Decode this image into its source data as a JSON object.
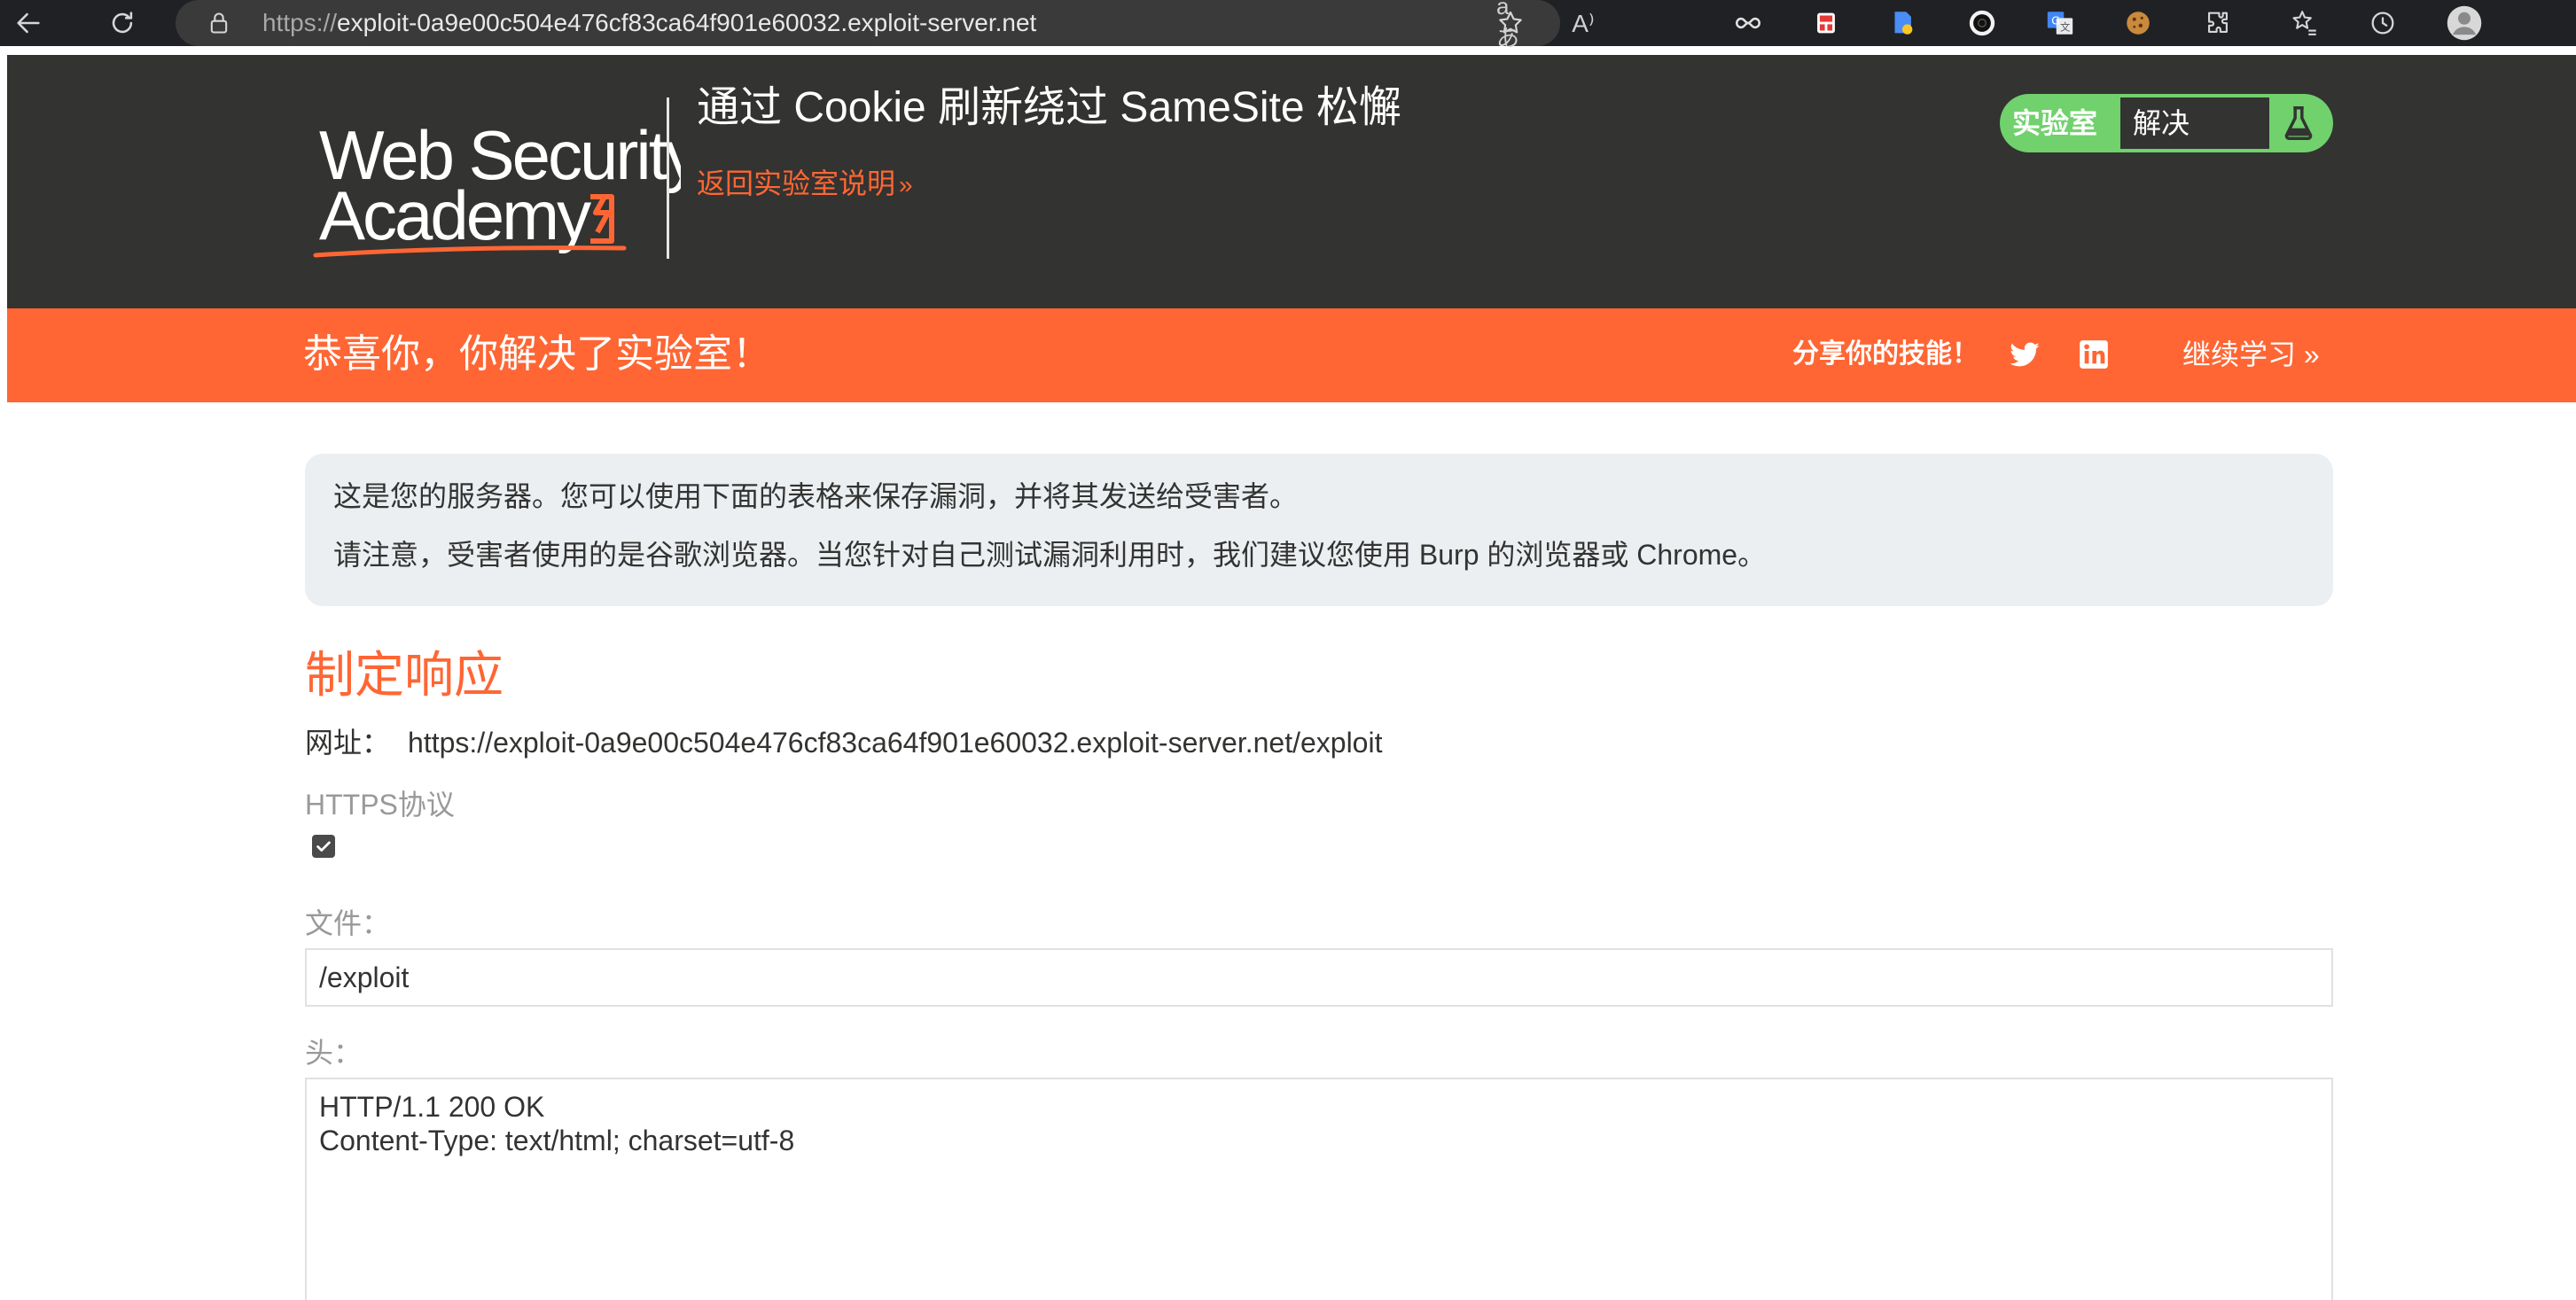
{
  "browser": {
    "url_protocol": "https://",
    "url_host": "exploit-0a9e00c504e476cf83ca64f901e60032.exploit-server.net",
    "translate_icon": "aあ",
    "read_aloud_icon": "A⁾"
  },
  "header": {
    "logo_line1": "Web Security",
    "logo_line2": "Academy",
    "lab_title": "通过 Cookie 刷新绕过 SameSite 松懈",
    "back_link": "返回实验室说明",
    "back_chevron": "»",
    "status_label": "实验室",
    "status_value": "解决"
  },
  "banner": {
    "congrats": "恭喜你，你解决了实验室！",
    "share": "分享你的技能！",
    "continue": "继续学习",
    "continue_chevron": "»"
  },
  "info": {
    "line1": "这是您的服务器。您可以使用下面的表格来保存漏洞，并将其发送给受害者。",
    "line2": "请注意，受害者使用的是谷歌浏览器。当您针对自己测试漏洞利用时，我们建议您使用 Burp 的浏览器或 Chrome。"
  },
  "form": {
    "section_title": "制定响应",
    "url_label": "网址：",
    "url_value": "https://exploit-0a9e00c504e476cf83ca64f901e60032.exploit-server.net/exploit",
    "https_label": "HTTPS协议",
    "https_checked": true,
    "file_label": "文件：",
    "file_value": "/exploit",
    "head_label": "头：",
    "head_value": "HTTP/1.1 200 OK\nContent-Type: text/html; charset=utf-8"
  },
  "colors": {
    "brand_orange": "#ff6633",
    "header_dark": "#333332",
    "solved_green": "#70d16d",
    "info_bg": "#ebeff2"
  },
  "icons": [
    "back-arrow-icon",
    "refresh-icon",
    "lock-icon",
    "translate-icon",
    "read-aloud-icon",
    "favorite-star-icon",
    "infinity-extension-icon",
    "extension-red-icon",
    "extension-file-icon",
    "extension-black-circle-icon",
    "google-translate-icon",
    "cookie-icon",
    "puzzle-extensions-icon",
    "favorites-icon",
    "history-icon",
    "profile-avatar-icon",
    "twitter-icon",
    "linkedin-icon",
    "flask-icon",
    "checkbox-check-icon"
  ]
}
